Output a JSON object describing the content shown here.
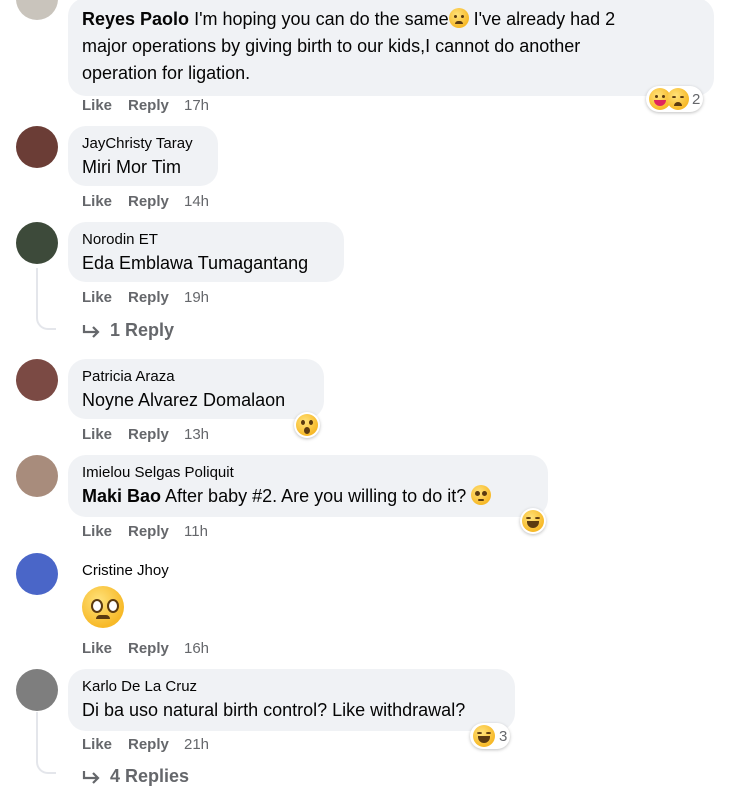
{
  "comments": [
    {
      "author": "",
      "mention": "Reyes Paolo",
      "text_line1": " I'm hoping you can do the same",
      "text_line1b": " I've already had 2",
      "text_line2": "major operations by giving birth to our kids,I cannot do another",
      "text_line3": "operation for ligation.",
      "like": "Like",
      "reply": "Reply",
      "time": "17h",
      "reaction_count": "2",
      "colors": {
        "avatar": "#c9c4bc"
      }
    },
    {
      "author": "JayChristy Taray",
      "text": "Miri Mor Tim",
      "like": "Like",
      "reply": "Reply",
      "time": "14h",
      "colors": {
        "avatar": "#6b3d36"
      }
    },
    {
      "author": "Norodin ET",
      "text": "Eda Emblawa Tumagantang",
      "like": "Like",
      "reply": "Reply",
      "time": "19h",
      "replies": "1 Reply",
      "colors": {
        "avatar": "#3d4a3a"
      }
    },
    {
      "author": "Patricia Araza",
      "text": "Noyne Alvarez Domalaon",
      "like": "Like",
      "reply": "Reply",
      "time": "13h",
      "colors": {
        "avatar": "#7b4a44"
      }
    },
    {
      "author": "Imielou Selgas Poliquit",
      "mention": "Maki Bao",
      "text": " After baby #2. Are you willing to do it?",
      "like": "Like",
      "reply": "Reply",
      "time": "11h",
      "colors": {
        "avatar": "#a88c7c"
      }
    },
    {
      "author": "Cristine Jhoy",
      "text": "",
      "like": "Like",
      "reply": "Reply",
      "time": "16h",
      "colors": {
        "avatar": "#4a66c8"
      }
    },
    {
      "author": "Karlo De La Cruz",
      "text": "Di ba uso natural birth control? Like withdrawal?",
      "like": "Like",
      "reply": "Reply",
      "time": "21h",
      "reaction_count": "3",
      "replies": "4 Replies",
      "colors": {
        "avatar": "#7e7e7e"
      }
    }
  ],
  "icons": {
    "reply_arrow": "reply-arrow-icon",
    "emojis": [
      "sad-emoji",
      "wow-emoji",
      "laugh-emoji",
      "care-emoji",
      "pleading-emoji",
      "crying-emoji"
    ]
  },
  "theme": {
    "bubble": "#f0f2f5",
    "meta": "#65676b",
    "text": "#050505"
  }
}
